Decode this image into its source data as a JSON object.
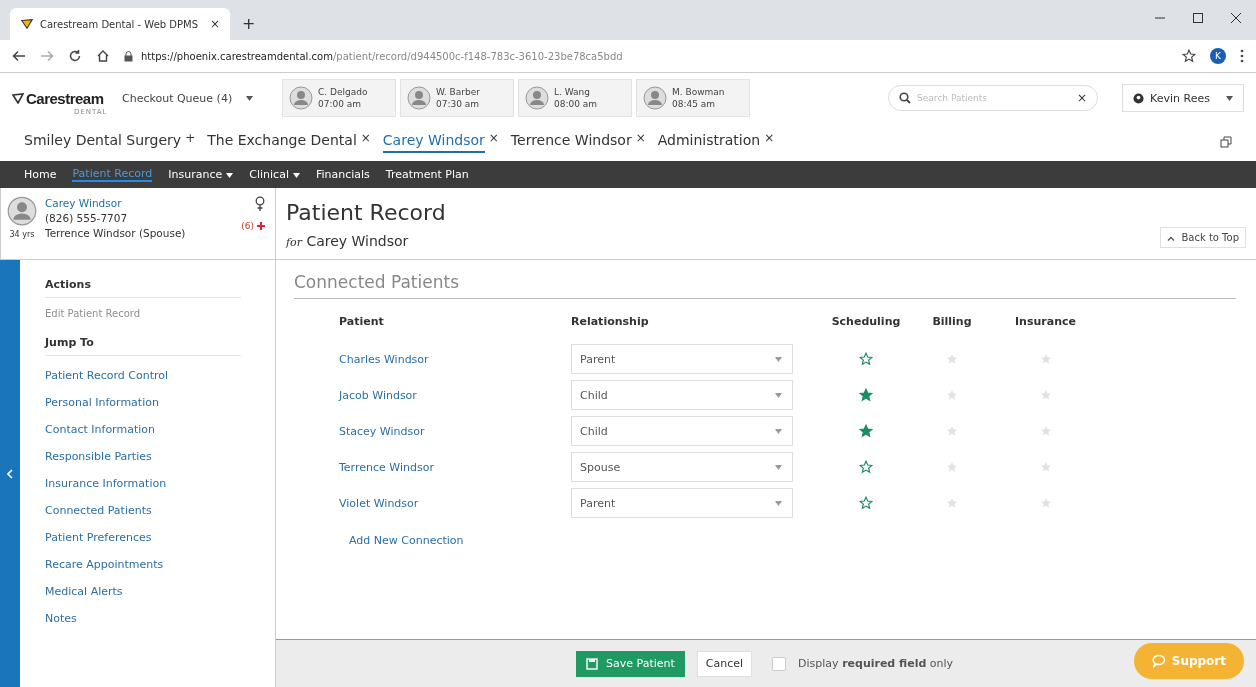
{
  "browser": {
    "tab_title": "Carestream Dental - Web DPMS",
    "tab_close": "×",
    "new_tab": "+",
    "url_host": "https://phoenix.carestreamdental.com",
    "url_path": "/patient/record/d944500c-f148-783c-3610-23be78ca5bdd",
    "profile_initial": "K"
  },
  "header": {
    "logo": "Carestream",
    "logo_sub": "DENTAL",
    "queue": "Checkout Queue (4)",
    "appointments": [
      {
        "name": "C. Delgado",
        "time": "07:00 am"
      },
      {
        "name": "W. Barber",
        "time": "07:30 am"
      },
      {
        "name": "L. Wang",
        "time": "08:00 am"
      },
      {
        "name": "M. Bowman",
        "time": "08:45 am"
      }
    ],
    "search": {
      "placeholder": "Search Patients",
      "clear": "×"
    },
    "user": "Kevin Rees"
  },
  "record_tabs": [
    {
      "label": "Smiley Dental Surgery",
      "mark": "+",
      "selected": false
    },
    {
      "label": "The Exchange Dental",
      "mark": "×",
      "selected": false
    },
    {
      "label": "Carey Windsor",
      "mark": "×",
      "selected": true
    },
    {
      "label": "Terrence Windsor",
      "mark": "×",
      "selected": false
    },
    {
      "label": "Administration",
      "mark": "×",
      "selected": false
    }
  ],
  "nav": [
    {
      "label": "Home",
      "selected": false,
      "dropdown": false
    },
    {
      "label": "Patient Record",
      "selected": true,
      "dropdown": false
    },
    {
      "label": "Insurance",
      "selected": false,
      "dropdown": true
    },
    {
      "label": "Clinical",
      "selected": false,
      "dropdown": true
    },
    {
      "label": "Financials",
      "selected": false,
      "dropdown": false
    },
    {
      "label": "Treatment Plan",
      "selected": false,
      "dropdown": false
    }
  ],
  "patient_card": {
    "name": "Carey Windsor",
    "phone": "(826) 555-7707",
    "age": "34 yrs",
    "contact": "Terrence Windsor (Spouse)",
    "alerts": "(6)"
  },
  "sidebar": {
    "actions_title": "Actions",
    "actions": [
      {
        "label": "Edit Patient Record",
        "disabled": true
      }
    ],
    "jump_title": "Jump To",
    "jump_items": [
      "Patient Record Control",
      "Personal Information",
      "Contact Information",
      "Responsible Parties",
      "Insurance Information",
      "Connected Patients",
      "Patient Preferences",
      "Recare Appointments",
      "Medical Alerts",
      "Notes"
    ]
  },
  "page": {
    "title": "Patient Record",
    "subtitle_prefix": "for",
    "subtitle": "Carey Windsor",
    "back_to_top": "Back to Top"
  },
  "section": {
    "title": "Connected Patients",
    "columns": [
      "Patient",
      "Relationship",
      "Scheduling",
      "Billing",
      "Insurance"
    ],
    "rows": [
      {
        "patient": "Charles Windsor",
        "relationship": "Parent",
        "scheduling": false
      },
      {
        "patient": "Jacob Windsor",
        "relationship": "Child",
        "scheduling": true
      },
      {
        "patient": "Stacey Windsor",
        "relationship": "Child",
        "scheduling": true
      },
      {
        "patient": "Terrence Windsor",
        "relationship": "Spouse",
        "scheduling": false
      },
      {
        "patient": "Violet Windsor",
        "relationship": "Parent",
        "scheduling": false
      }
    ],
    "add_link": "Add New Connection"
  },
  "footer": {
    "save": "Save Patient",
    "cancel": "Cancel",
    "required_only": {
      "label": "Display **required field** only",
      "checked": false
    },
    "support": "Support"
  }
}
